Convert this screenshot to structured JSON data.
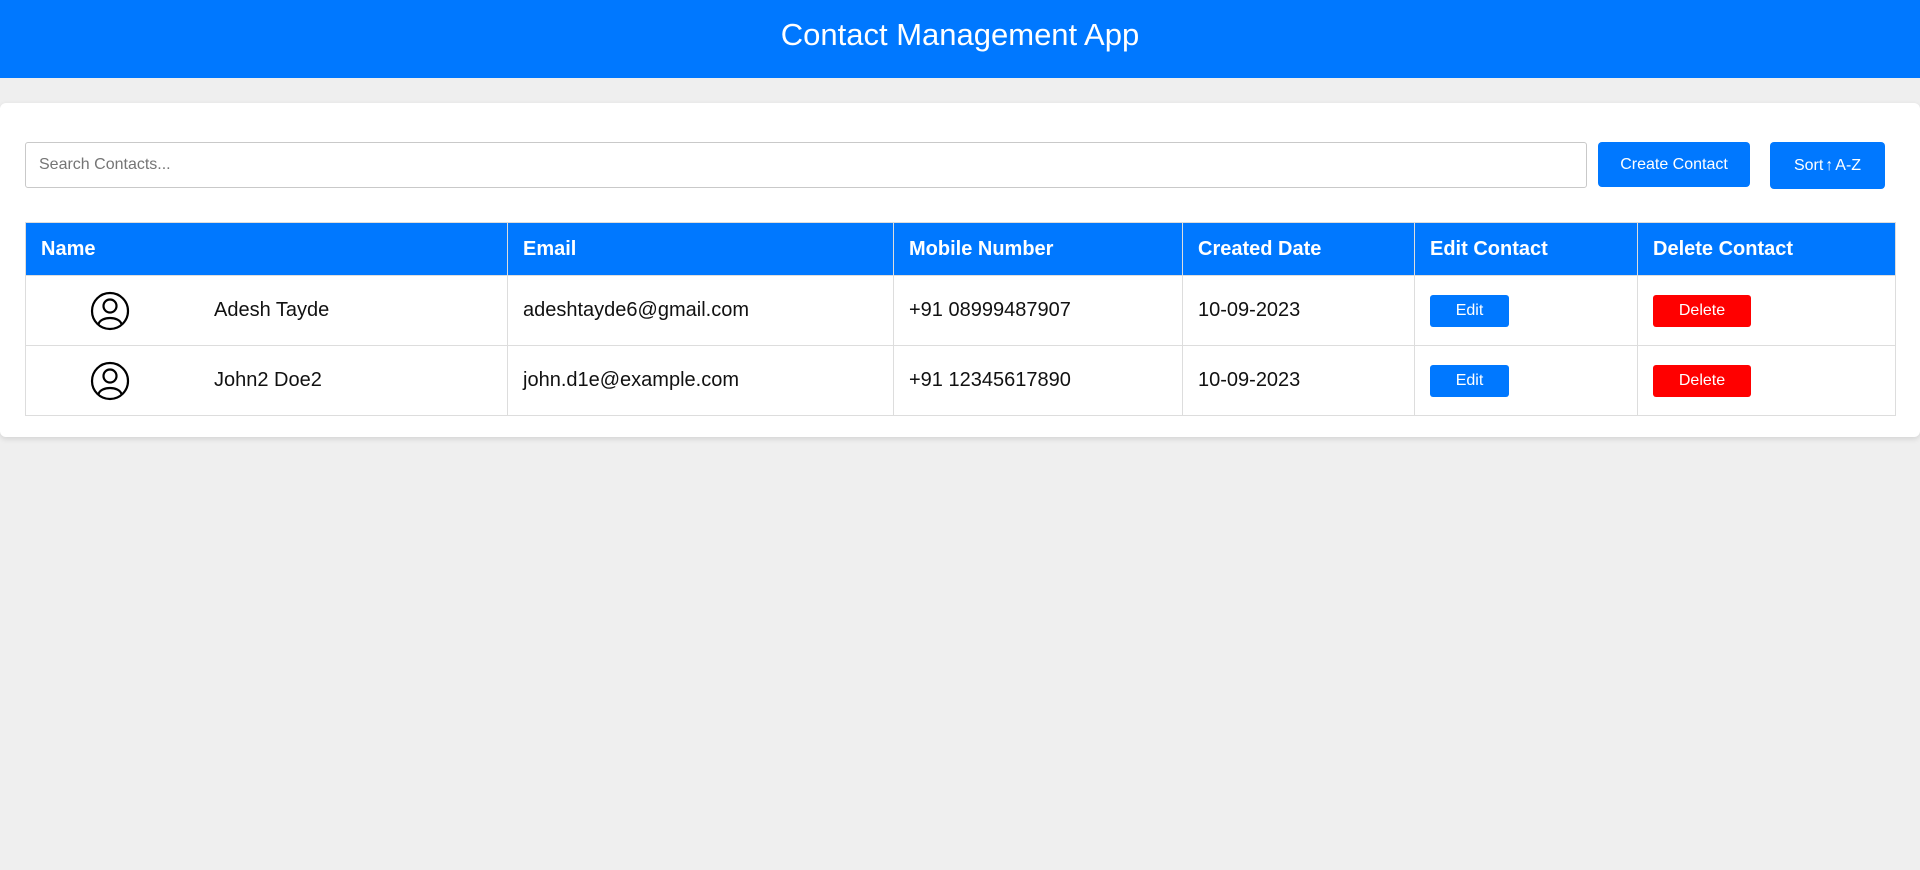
{
  "header": {
    "title": "Contact Management App",
    "color": "#0078ff"
  },
  "toolbar": {
    "search_placeholder": "Search Contacts...",
    "search_value": "",
    "create_label": "Create Contact",
    "sort_label_prefix": "Sort",
    "sort_arrow": "↑",
    "sort_label_suffix": "A-Z"
  },
  "table": {
    "columns": [
      "Name",
      "Email",
      "Mobile Number",
      "Created Date",
      "Edit Contact",
      "Delete Contact"
    ],
    "rows": [
      {
        "avatar_icon": "user-circle-icon",
        "name": "Adesh Tayde",
        "email": "adeshtayde6@gmail.com",
        "mobile": "+91 08999487907",
        "created": "10-09-2023",
        "edit_label": "Edit",
        "delete_label": "Delete"
      },
      {
        "avatar_icon": "user-circle-icon",
        "name": "John2 Doe2",
        "email": "john.d1e@example.com",
        "mobile": "+91 12345617890",
        "created": "10-09-2023",
        "edit_label": "Edit",
        "delete_label": "Delete"
      }
    ]
  },
  "colors": {
    "primary": "#0078ff",
    "danger": "#ff0000",
    "background": "#efefef"
  }
}
